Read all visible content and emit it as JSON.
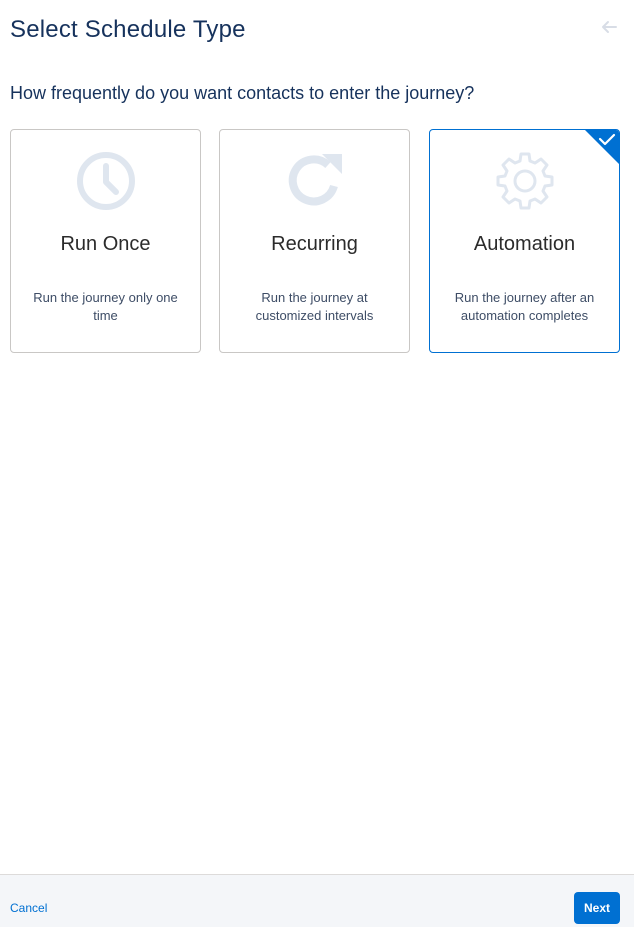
{
  "header": {
    "title": "Select Schedule Type",
    "back_icon": "arrow-left-icon"
  },
  "question": "How frequently do you want contacts to enter the journey?",
  "options": [
    {
      "name": "Run Once",
      "description": "Run the journey only one time",
      "icon": "clock-icon",
      "selected": false
    },
    {
      "name": "Recurring",
      "description": "Run the journey at customized intervals",
      "icon": "refresh-icon",
      "selected": false
    },
    {
      "name": "Automation",
      "description": "Run the journey after an automation completes",
      "icon": "gear-icon",
      "selected": true
    }
  ],
  "footer": {
    "cancel_label": "Cancel",
    "next_label": "Next"
  },
  "colors": {
    "accent": "#0070d2",
    "title": "#16325c",
    "icon": "#dfe6ef"
  }
}
